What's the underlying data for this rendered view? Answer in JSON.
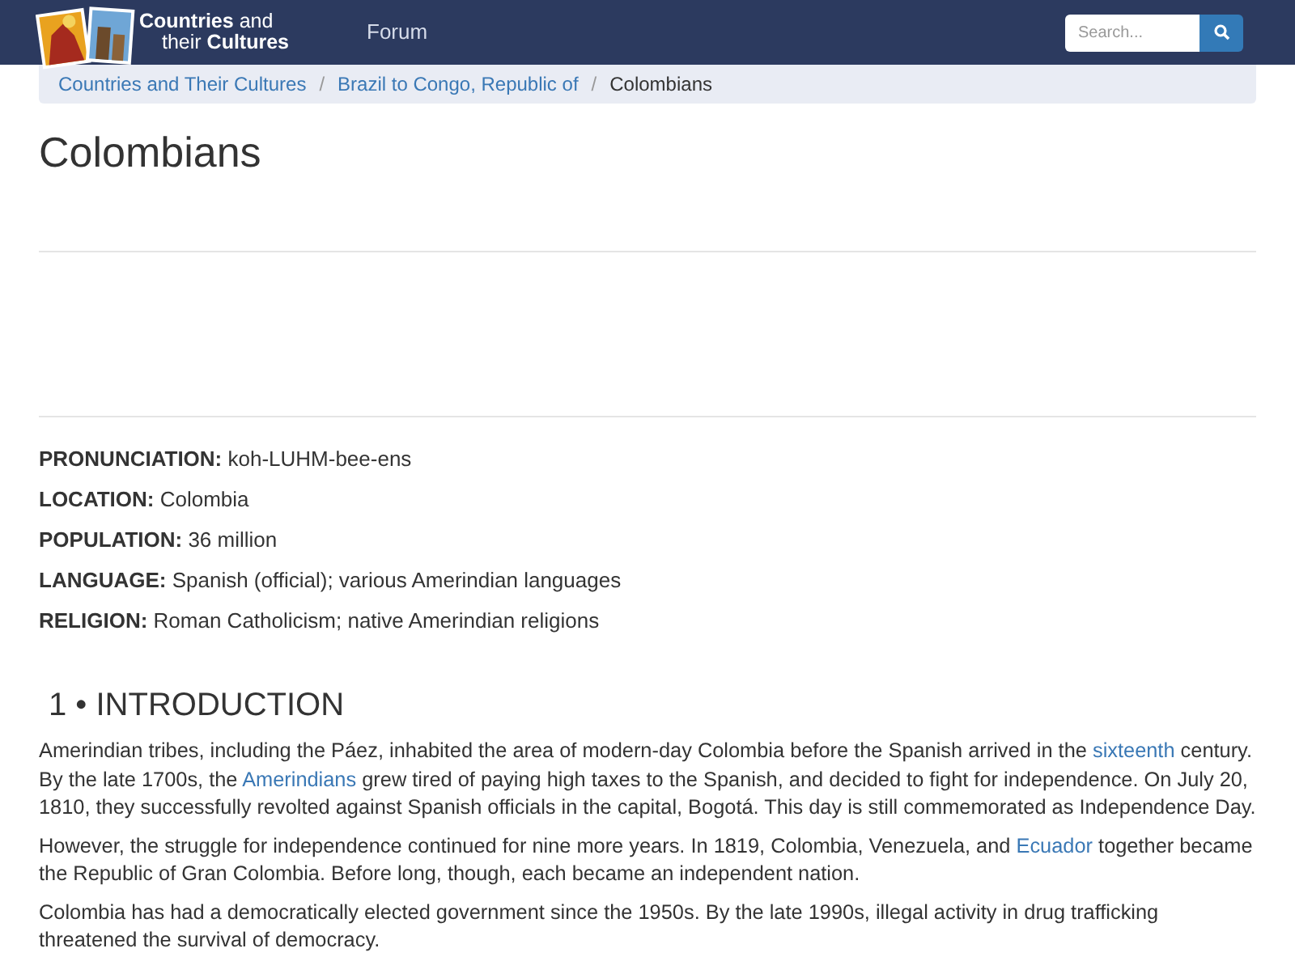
{
  "header": {
    "logo_lines": [
      "**Countries** and",
      "their **Cultures**"
    ],
    "nav": [
      "Forum"
    ],
    "search": {
      "placeholder": "Search..."
    }
  },
  "breadcrumb_separator": "/",
  "breadcrumb": [
    {
      "label": "Countries and Their Cultures",
      "kind": "link"
    },
    {
      "label": "Brazil to Congo, Republic of",
      "kind": "link"
    },
    {
      "label": "Colombians",
      "kind": "current"
    }
  ],
  "title": "Colombians",
  "facts": [
    {
      "label": "PRONUNCIATION:",
      "value": "koh-LUHM-bee-ens"
    },
    {
      "label": "LOCATION:",
      "value": "Colombia"
    },
    {
      "label": "POPULATION:",
      "value": "36 million"
    },
    {
      "label": "LANGUAGE:",
      "value": "Spanish (official); various Amerindian languages"
    },
    {
      "label": "RELIGION:",
      "value": "Roman Catholicism; native Amerindian religions"
    }
  ],
  "section_heading": "1 • INTRODUCTION",
  "paragraphs": [
    [
      {
        "kind": "text",
        "text": "Amerindian tribes, including the Páez, inhabited the area of modern-day Colombia before the Spanish arrived in the "
      },
      {
        "kind": "link",
        "text": "sixteenth"
      },
      {
        "kind": "text",
        "text": " century. By the late 1700s, the "
      },
      {
        "kind": "link",
        "text": "Amerindians"
      },
      {
        "kind": "text",
        "text": " grew tired of paying high taxes to the Spanish, and decided to fight for independence. On July 20, 1810, they successfully revolted against Spanish officials in the capital, Bogotá. This day is still commemorated as Independence Day."
      }
    ],
    [
      {
        "kind": "text",
        "text": "However, the struggle for independence continued for nine more years. In 1819, Colombia, Venezuela, and "
      },
      {
        "kind": "link",
        "text": "Ecuador"
      },
      {
        "kind": "text",
        "text": " together became the Republic of Gran Colombia. Before long, though, each became an independent nation."
      }
    ],
    [
      {
        "kind": "text",
        "text": "Colombia has had a democratically elected government since the 1950s. By the late 1990s, illegal activity in drug trafficking threatened the survival of democracy."
      }
    ]
  ]
}
